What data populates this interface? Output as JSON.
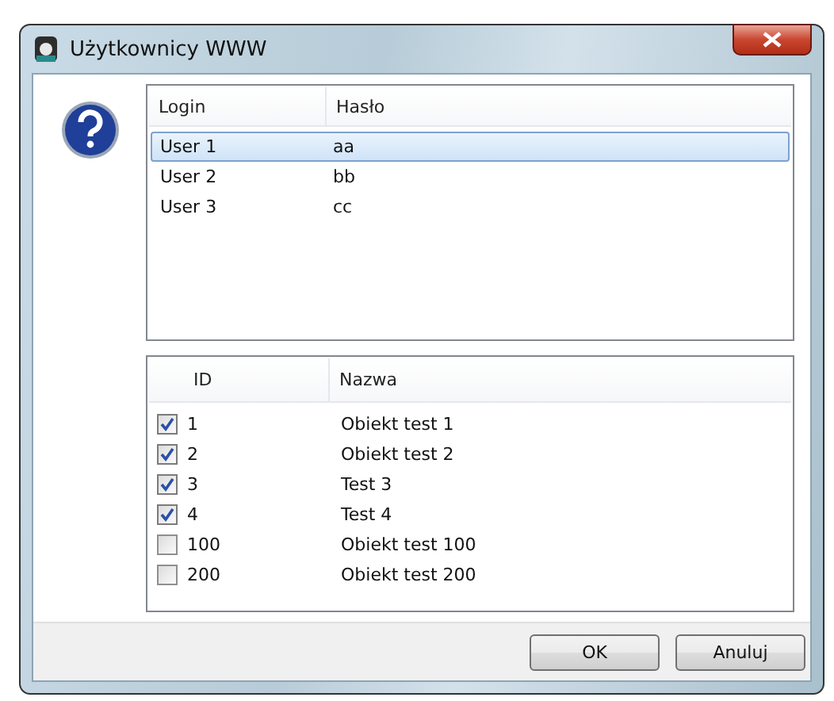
{
  "window": {
    "title": "Użytkownicy WWW"
  },
  "users": {
    "columns": [
      "Login",
      "Hasło"
    ],
    "rows": [
      {
        "login": "User 1",
        "password": "aa",
        "selected": true
      },
      {
        "login": "User 2",
        "password": "bb",
        "selected": false
      },
      {
        "login": "User 3",
        "password": "cc",
        "selected": false
      }
    ]
  },
  "objects": {
    "columns": [
      "ID",
      "Nazwa"
    ],
    "rows": [
      {
        "id": "1",
        "name": "Obiekt test 1",
        "checked": true
      },
      {
        "id": "2",
        "name": "Obiekt test 2",
        "checked": true
      },
      {
        "id": "3",
        "name": "Test 3",
        "checked": true
      },
      {
        "id": "4",
        "name": "Test 4",
        "checked": true
      },
      {
        "id": "100",
        "name": "Obiekt test 100",
        "checked": false
      },
      {
        "id": "200",
        "name": "Obiekt test 200",
        "checked": false
      }
    ]
  },
  "buttons": [
    "OK",
    "Anuluj"
  ]
}
